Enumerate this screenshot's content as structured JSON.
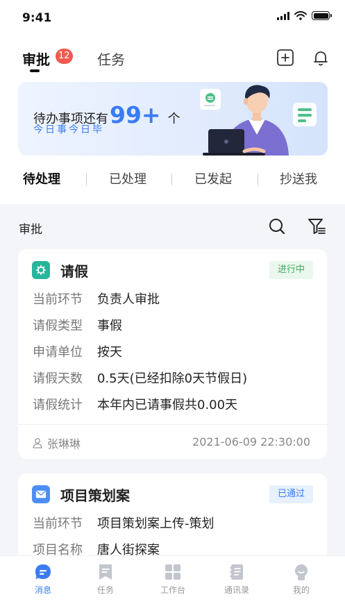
{
  "status_bar": {
    "time": "9:41"
  },
  "header": {
    "tabs": [
      {
        "label": "审批",
        "badge": "12",
        "active": true
      },
      {
        "label": "任务",
        "active": false
      }
    ]
  },
  "banner": {
    "text_before": "待办事项还有",
    "count": "99+",
    "text_after": "个",
    "subtitle": "今日事今日毕"
  },
  "subtabs": [
    "待处理",
    "已处理",
    "已发起",
    "抄送我"
  ],
  "section": {
    "title": "审批"
  },
  "cards": [
    {
      "title": "请假",
      "status": "进行中",
      "fields": [
        {
          "label": "当前环节",
          "value": "负责人审批"
        },
        {
          "label": "请假类型",
          "value": "事假"
        },
        {
          "label": "申请单位",
          "value": "按天"
        },
        {
          "label": "请假天数",
          "value": "0.5天(已经扣除0天节假日)"
        },
        {
          "label": "请假统计",
          "value": "本年内已请事假共0.00天"
        }
      ],
      "applicant": "张琳琳",
      "datetime": "2021-06-09   22:30:00"
    },
    {
      "title": "项目策划案",
      "status": "已通过",
      "fields": [
        {
          "label": "当前环节",
          "value": "项目策划案上传-策划"
        },
        {
          "label": "项目名称",
          "value": "唐人街探案"
        }
      ]
    }
  ],
  "tabbar": [
    {
      "label": "消息",
      "icon": "message-icon",
      "active": true
    },
    {
      "label": "任务",
      "icon": "task-icon",
      "active": false
    },
    {
      "label": "工作台",
      "icon": "workbench-icon",
      "active": false
    },
    {
      "label": "通讯录",
      "icon": "contacts-icon",
      "active": false
    },
    {
      "label": "我的",
      "icon": "profile-icon",
      "active": false
    }
  ],
  "colors": {
    "accent": "#3a7bf3",
    "badge": "#f05a4f",
    "in_progress": "#3daa62",
    "leave_icon": "#27b59b"
  }
}
